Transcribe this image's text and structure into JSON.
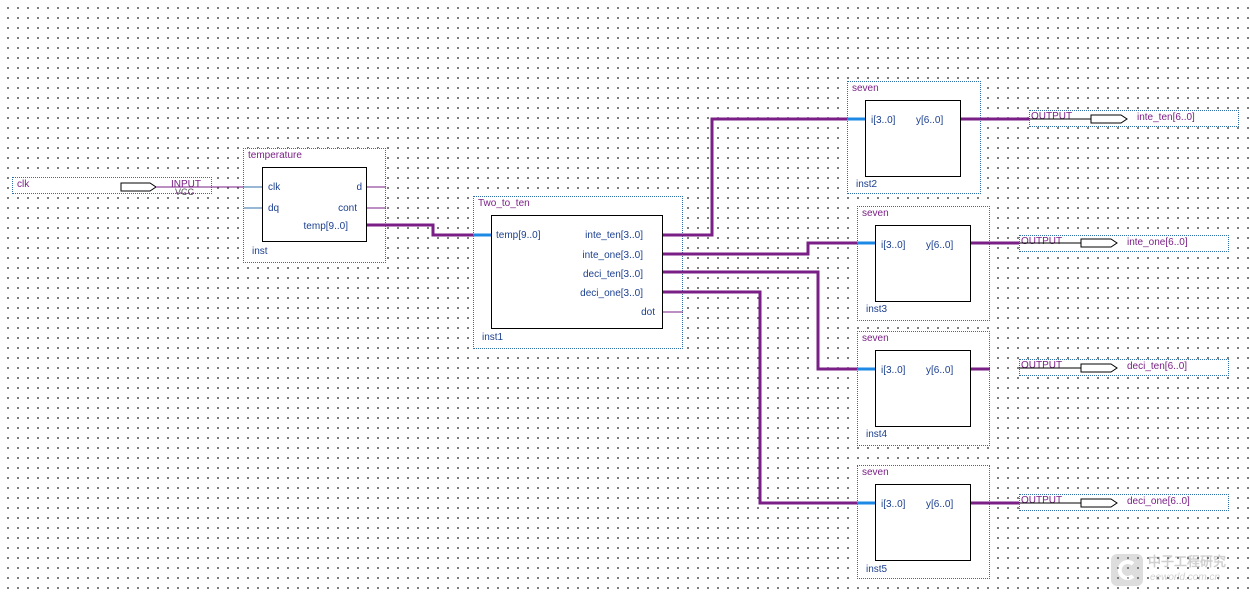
{
  "colors": {
    "bus": "#7a1f86",
    "wire": "#7a1f86",
    "port_marker": "#1e88e5",
    "frame": "#2f6fa8"
  },
  "pins": {
    "clk": {
      "name": "clk",
      "kind": "INPUT",
      "vcc": "VCC"
    },
    "inte_ten": {
      "name": "inte_ten[6..0]",
      "kind": "OUTPUT"
    },
    "inte_one": {
      "name": "inte_one[6..0]",
      "kind": "OUTPUT"
    },
    "deci_ten": {
      "name": "deci_ten[6..0]",
      "kind": "OUTPUT"
    },
    "deci_one": {
      "name": "deci_one[6..0]",
      "kind": "OUTPUT"
    }
  },
  "blocks": {
    "temperature": {
      "type": "temperature",
      "instance": "inst",
      "inputs": [
        "clk",
        "dq"
      ],
      "outputs": [
        "d",
        "cont",
        "temp[9..0]"
      ]
    },
    "two_to_ten": {
      "type": "Two_to_ten",
      "instance": "inst1",
      "inputs": [
        "temp[9..0]"
      ],
      "outputs": [
        "inte_ten[3..0]",
        "inte_one[3..0]",
        "deci_ten[3..0]",
        "deci_one[3..0]",
        "dot"
      ]
    },
    "seven2": {
      "type": "seven",
      "instance": "inst2",
      "input": "i[3..0]",
      "output": "y[6..0]"
    },
    "seven3": {
      "type": "seven",
      "instance": "inst3",
      "input": "i[3..0]",
      "output": "y[6..0]"
    },
    "seven4": {
      "type": "seven",
      "instance": "inst4",
      "input": "i[3..0]",
      "output": "y[6..0]"
    },
    "seven5": {
      "type": "seven",
      "instance": "inst5",
      "input": "i[3..0]",
      "output": "y[6..0]"
    }
  },
  "watermark": {
    "icon": "c-logo-icon",
    "line1": "中子工程研究",
    "line2": "eeworld.com.cn"
  }
}
